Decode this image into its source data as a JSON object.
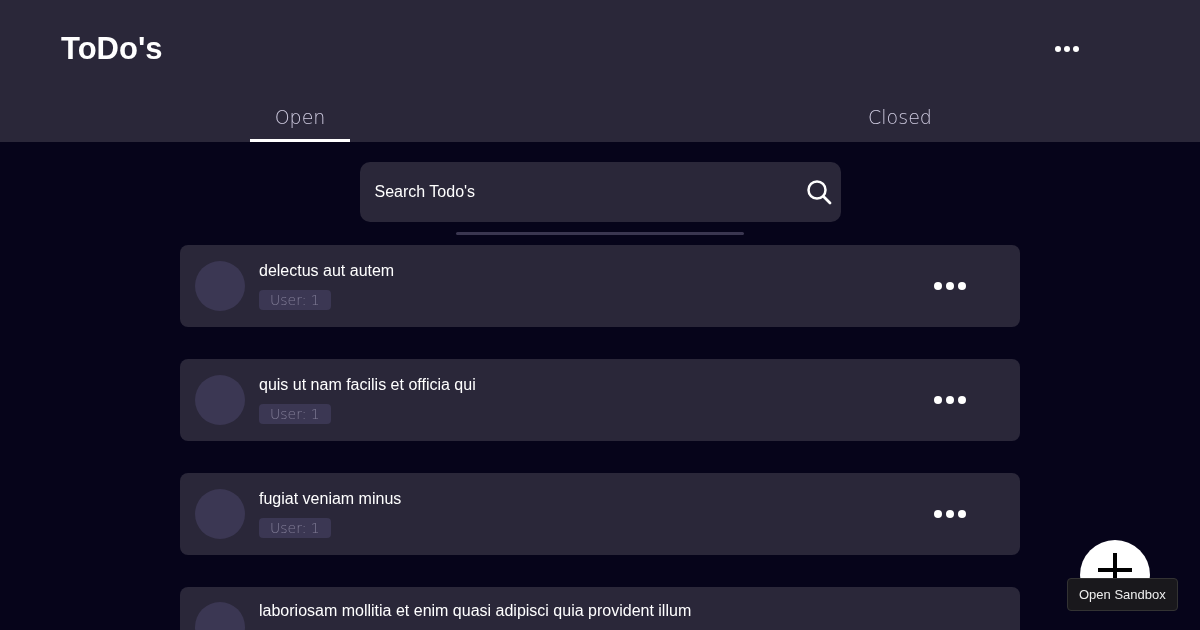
{
  "app": {
    "title": "ToDo's"
  },
  "tabs": [
    {
      "label": "Open",
      "selected": true
    },
    {
      "label": "Closed",
      "selected": false
    }
  ],
  "search": {
    "placeholder": "Search Todo's"
  },
  "todos": [
    {
      "title": "delectus aut autem",
      "user": "User: 1"
    },
    {
      "title": "quis ut nam facilis et officia qui",
      "user": "User: 1"
    },
    {
      "title": "fugiat veniam minus",
      "user": "User: 1"
    },
    {
      "title": "laboriosam mollitia et enim quasi adipisci quia provident illum"
    }
  ],
  "tooltip": "Open Sandbox"
}
